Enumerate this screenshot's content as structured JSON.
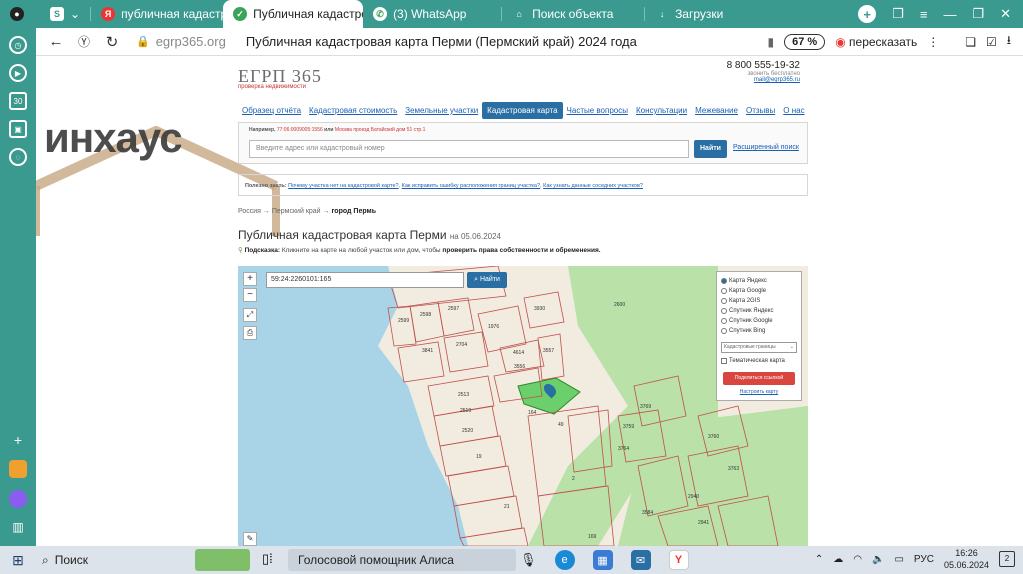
{
  "tabs": [
    {
      "label": "",
      "icon": "profile-icon"
    },
    {
      "label": "S",
      "icon": "s-icon"
    },
    {
      "label": "публичная кадастровая",
      "icon": "yandex-icon"
    },
    {
      "label": "Публичная кадастро",
      "icon": "check-icon",
      "active": true
    },
    {
      "label": "(3) WhatsApp",
      "icon": "whatsapp-icon"
    },
    {
      "label": "Поиск объекта",
      "icon": "rosreestr-icon"
    },
    {
      "label": "Загрузки",
      "icon": "download-icon"
    }
  ],
  "addressbar": {
    "host": "egrp365.org",
    "title": "Публичная кадастровая карта Перми (Пермский край) 2024 года",
    "zoom": "67 %",
    "translate": "пересказать"
  },
  "site": {
    "logo": "ЕГРП 365",
    "logo_sub": "проверка недвижимости",
    "phone": "8 800 555-19-32",
    "phone_note": "звонить бесплатно",
    "email": "mail@egrp365.ru",
    "menu": [
      "Образец отчёта",
      "Кадастровая стоимость",
      "Земельные участки",
      "Кадастровая карта",
      "Частые вопросы",
      "Консультации",
      "Межевание",
      "Отзывы",
      "О нас"
    ],
    "menu_active": "Кадастровая карта"
  },
  "search": {
    "example_label": "Например,",
    "example_num": "77:06:0009005:1556",
    "example_or": "или",
    "example_addr": "Москва проезд Батайский дом 51 стр.1",
    "placeholder": "Введите адрес или кадастровый номер",
    "button": "Найти",
    "advanced": "Расширенный поиск"
  },
  "faq": {
    "label": "Полезно знать:",
    "links": [
      "Почему участка нет на кадастровой карте?",
      "Как исправить ошибку расположения границ участка?",
      "Как узнать данные соседних участков?"
    ]
  },
  "breadcrumb": [
    "Россия",
    "Пермский край",
    "город Пермь"
  ],
  "heading": "Публичная кадастровая карта Перми",
  "heading_date": "на 05.06.2024",
  "hint_label": "Подсказка:",
  "hint_text": "Кликните на карте на любой участок или дом, чтобы",
  "hint_bold": "проверить права собственности и обременения.",
  "map": {
    "cadastral_input": "59:24:2260101:165",
    "find": "Найти",
    "layers": [
      "Карта Яндекс",
      "Карта Google",
      "Карта 2GIS",
      "Спутник Яндекс",
      "Спутник Google",
      "Спутник Bing"
    ],
    "layer_selected": "Карта Яндекс",
    "boundary_select": "Кадастровые границы",
    "thematic": "Тематическая карта",
    "share": "Поделиться ссылкой",
    "configure": "Настроить карту",
    "parcels": [
      "4355",
      "2599",
      "2598",
      "2597",
      "1976",
      "3930",
      "2600",
      "3841",
      "2704",
      "4614",
      "3557",
      "3556",
      "2513",
      "2519",
      "2520",
      "164",
      "49",
      "3769",
      "3759",
      "3760",
      "3764",
      "19",
      "2",
      "3763",
      "2940",
      "3584",
      "2941",
      "21",
      "169"
    ]
  },
  "watermark": "инхаус",
  "taskbar": {
    "search": "Поиск",
    "alice": "Голосовой помощник Алиса",
    "lang": "РУС",
    "time": "16:26",
    "date": "05.06.2024",
    "notifications": "2"
  },
  "colors": {
    "browser_chrome": "#3a9a90",
    "link": "#1a5fb4",
    "primary_button": "#2a6fa3",
    "share_button": "#d9453f"
  }
}
